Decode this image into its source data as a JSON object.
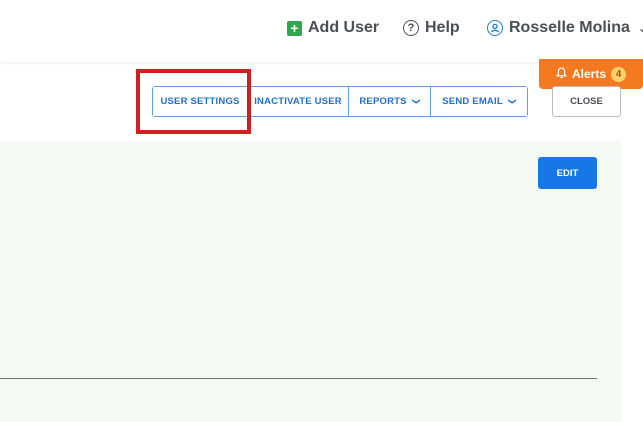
{
  "header": {
    "add_user_label": "Add User",
    "help_label": "Help",
    "user_name": "Rosselle Molina",
    "add_user_icon": "plus-square-icon",
    "help_icon": "question-circle-icon",
    "user_icon": "user-circle-icon",
    "caret_icon": "chevron-down-icon"
  },
  "alerts": {
    "label": "Alerts",
    "count": "4",
    "icon": "bell-icon",
    "color": "#f47920"
  },
  "toolbar": {
    "user_settings_label": "USER SETTINGS",
    "inactivate_user_label": "INACTIVATE USER",
    "reports_label": "REPORTS",
    "send_email_label": "SEND EMAIL",
    "close_label": "CLOSE",
    "accent_color": "#1f6fd0"
  },
  "panel": {
    "edit_label": "EDIT",
    "background": "#f4f9f2"
  },
  "annotation": {
    "highlight_color": "#d11f1f",
    "highlighted_item": "USER SETTINGS"
  }
}
